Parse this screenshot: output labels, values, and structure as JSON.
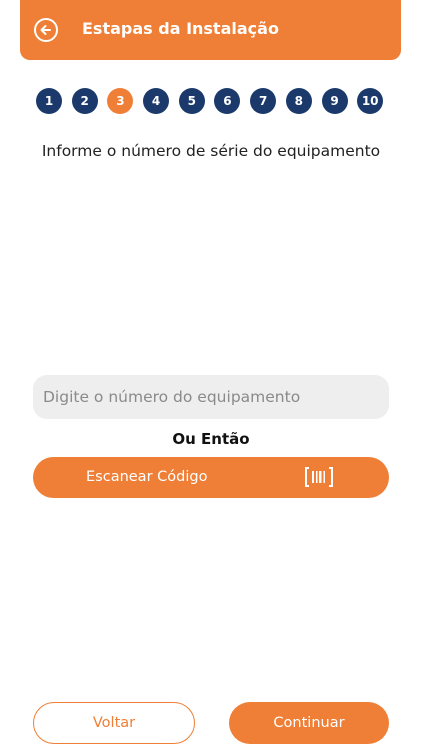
{
  "header": {
    "title": "Estapas da Instalação",
    "back_icon": "arrow-left-circle-icon"
  },
  "steps": {
    "items": [
      "1",
      "2",
      "3",
      "4",
      "5",
      "6",
      "7",
      "8",
      "9",
      "10"
    ],
    "active": "3"
  },
  "instruction": "Informe o número de série do equipamento",
  "serial_input": {
    "placeholder": "Digite o número do equipamento",
    "value": ""
  },
  "or_label": "Ou Então",
  "scan_button": {
    "label": "Escanear Código",
    "icon": "barcode-icon"
  },
  "footer": {
    "back_label": "Voltar",
    "continue_label": "Continuar"
  },
  "colors": {
    "accent": "#ef7f36",
    "step_default": "#1b3a6b",
    "input_bg": "#eeeeee"
  }
}
